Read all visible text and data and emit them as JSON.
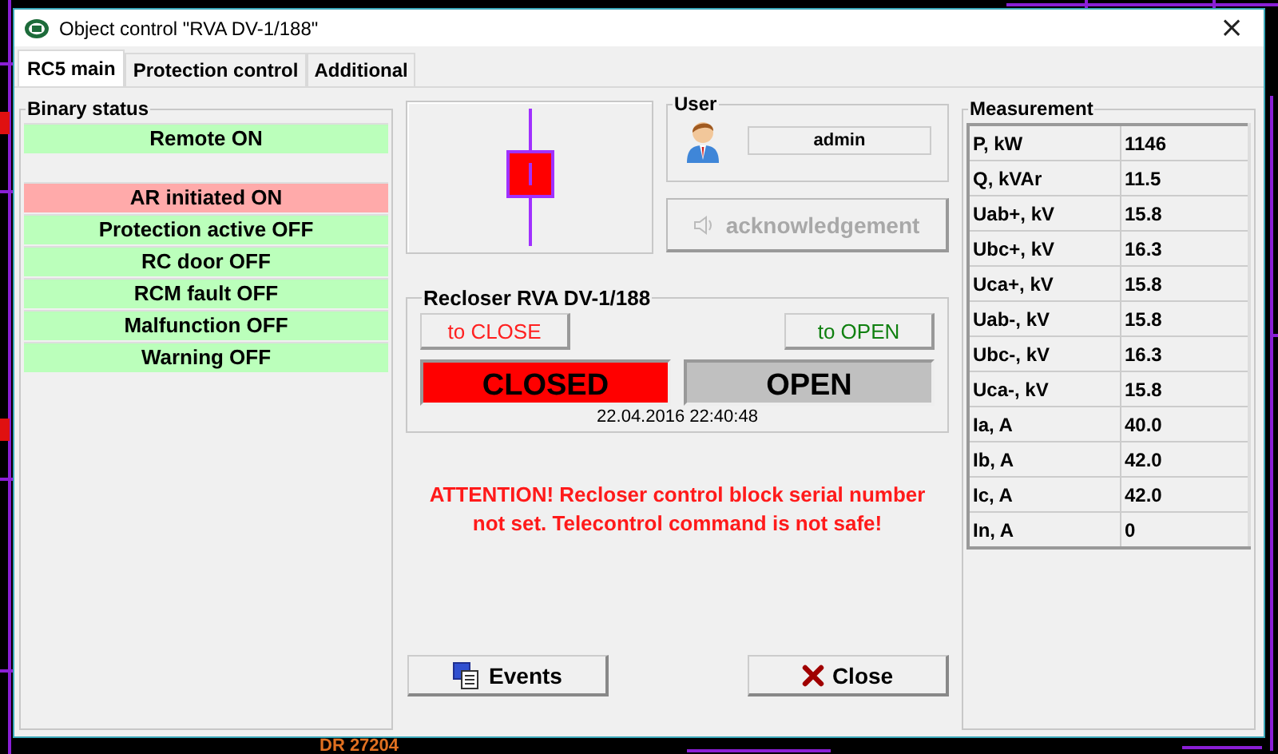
{
  "backdrop_labels": [
    {
      "text": "DR 27204"
    }
  ],
  "window": {
    "title": "Object control \"RVA DV-1/188\"",
    "close": "×"
  },
  "tabs": [
    {
      "label": "RC5 main",
      "selected": true
    },
    {
      "label": "Protection control",
      "selected": false
    },
    {
      "label": "Additional",
      "selected": false
    }
  ],
  "binary_status": {
    "title": "Binary status",
    "groups": [
      [
        {
          "label": "Remote ON",
          "color": "#bbffbb"
        }
      ],
      [
        {
          "label": "AR initiated ON",
          "color": "#ffaaaa"
        },
        {
          "label": "Protection active OFF",
          "color": "#bbffbb"
        },
        {
          "label": "RC door OFF",
          "color": "#bbffbb"
        },
        {
          "label": "RCM fault OFF",
          "color": "#bbffbb"
        },
        {
          "label": "Malfunction OFF",
          "color": "#bbffbb"
        },
        {
          "label": "Warning OFF",
          "color": "#bbffbb"
        }
      ]
    ]
  },
  "diagram": {
    "closed": true
  },
  "user": {
    "title": "User",
    "name": "admin"
  },
  "acknowledge": {
    "label": "acknowledgement",
    "disabled": true
  },
  "recloser": {
    "title": "Recloser RVA DV-1/188",
    "commands": [
      {
        "label": "to CLOSE",
        "kind": "close"
      },
      {
        "label": "to OPEN",
        "kind": "open"
      }
    ],
    "indicators": [
      {
        "label": "CLOSED",
        "kind": "closed",
        "active": true
      },
      {
        "label": "OPEN",
        "kind": "open",
        "active": false
      }
    ],
    "timestamp": "22.04.2016 22:40:48"
  },
  "warning": "ATTENTION! Recloser control block serial number\nnot set. Telecontrol command is not safe!",
  "buttons": [
    {
      "label": "Events",
      "kind": "events"
    },
    {
      "label": "Close",
      "kind": "close"
    }
  ],
  "measurement": {
    "title": "Measurement",
    "rows": [
      {
        "name": "P, kW",
        "value": "1146"
      },
      {
        "name": "Q, kVAr",
        "value": "11.5"
      },
      {
        "name": "Uab+, kV",
        "value": "15.8"
      },
      {
        "name": "Ubc+, kV",
        "value": "16.3"
      },
      {
        "name": "Uca+, kV",
        "value": "15.8"
      },
      {
        "name": "Uab-, kV",
        "value": "15.8"
      },
      {
        "name": "Ubc-, kV",
        "value": "16.3"
      },
      {
        "name": "Uca-, kV",
        "value": "15.8"
      },
      {
        "name": "Ia, A",
        "value": "40.0"
      },
      {
        "name": "Ib, A",
        "value": "42.0"
      },
      {
        "name": "Ic, A",
        "value": "42.0"
      },
      {
        "name": "In, A",
        "value": "0"
      }
    ]
  }
}
